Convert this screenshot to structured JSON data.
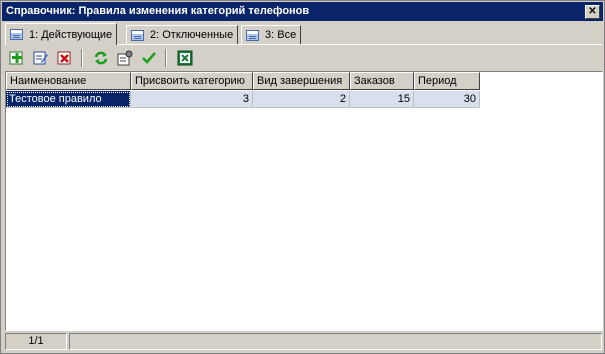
{
  "window": {
    "title": "Справочник: Правила изменения категорий телефонов",
    "close_glyph": "✕"
  },
  "tabs": [
    {
      "label": "1: Действующие",
      "active": true,
      "icon": "table-icon"
    },
    {
      "label": "2: Отключенные",
      "active": false,
      "icon": "table-icon"
    },
    {
      "label": "3: Все",
      "active": false,
      "icon": "table-icon"
    }
  ],
  "toolbar": {
    "buttons": [
      "add-icon",
      "edit-icon",
      "delete-icon",
      "refresh-icon",
      "properties-icon",
      "apply-checkmark-icon",
      "excel-export-icon"
    ]
  },
  "table": {
    "columns": [
      "Наименование",
      "Присвоить категорию",
      "Вид завершения",
      "Заказов",
      "Период"
    ],
    "rows": [
      [
        "Тестовое правило",
        "3",
        "2",
        "15",
        "30"
      ]
    ]
  },
  "status": {
    "position": "1/1"
  }
}
